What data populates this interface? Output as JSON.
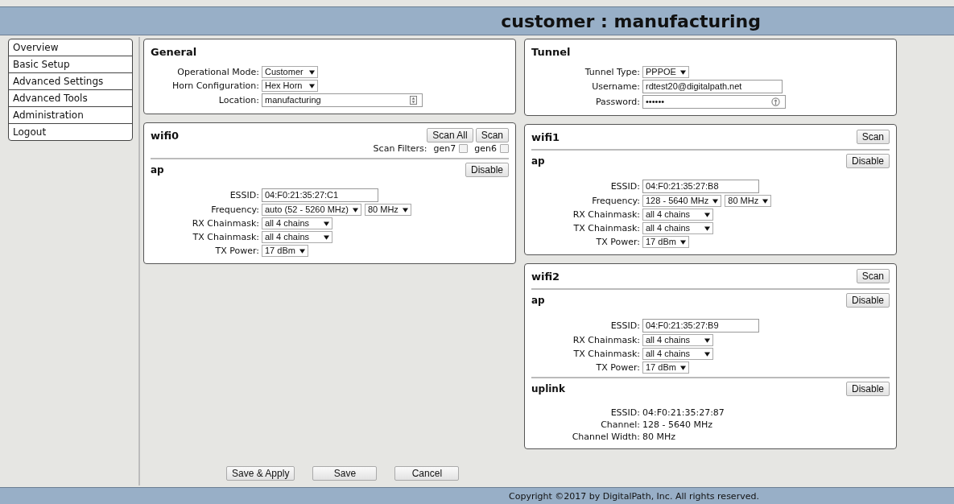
{
  "header": {
    "title": "customer : manufacturing"
  },
  "nav": [
    {
      "label": "Overview"
    },
    {
      "label": "Basic Setup"
    },
    {
      "label": "Advanced Settings"
    },
    {
      "label": "Advanced Tools"
    },
    {
      "label": "Administration"
    },
    {
      "label": "Logout"
    }
  ],
  "columns": [
    [
      {
        "title": "General",
        "fields": [
          {
            "label": "Operational Mode:",
            "controls": [
              {
                "kind": "select",
                "value": "Customer"
              }
            ]
          },
          {
            "label": "Horn Configuration:",
            "controls": [
              {
                "kind": "select",
                "value": "Hex Horn"
              }
            ]
          },
          {
            "label": "Location:",
            "controls": [
              {
                "kind": "autofill_input",
                "value": "manufacturing"
              }
            ]
          }
        ]
      },
      {
        "title": "wifi0",
        "buttons": [
          "Scan All",
          "Scan"
        ],
        "filters_label": "Scan Filters:",
        "filters": [
          {
            "label": "gen7",
            "checked": false
          },
          {
            "label": "gen6",
            "checked": false
          }
        ],
        "sections": [
          {
            "title": "ap",
            "button": "Disable",
            "fields": [
              {
                "label": "ESSID:",
                "controls": [
                  {
                    "kind": "input",
                    "value": "04:F0:21:35:27:C1"
                  }
                ]
              },
              {
                "label": "Frequency:",
                "controls": [
                  {
                    "kind": "select",
                    "value": "auto (52 - 5260 MHz)"
                  },
                  {
                    "kind": "select",
                    "value": "80 MHz"
                  }
                ]
              },
              {
                "label": "RX Chainmask:",
                "controls": [
                  {
                    "kind": "select",
                    "value": "all 4 chains"
                  }
                ]
              },
              {
                "label": "TX Chainmask:",
                "controls": [
                  {
                    "kind": "select",
                    "value": "all 4 chains"
                  }
                ]
              },
              {
                "label": "TX Power:",
                "controls": [
                  {
                    "kind": "select",
                    "value": "17 dBm"
                  }
                ]
              }
            ]
          }
        ]
      }
    ],
    [
      {
        "title": "Tunnel",
        "fields": [
          {
            "label": "Tunnel Type:",
            "controls": [
              {
                "kind": "select",
                "value": "PPPOE"
              }
            ]
          },
          {
            "label": "Username:",
            "controls": [
              {
                "kind": "input",
                "value": "rdtest20@digitalpath.net"
              }
            ]
          },
          {
            "label": "Password:",
            "controls": [
              {
                "kind": "password",
                "value": "••••••"
              }
            ]
          }
        ]
      },
      {
        "title": "wifi1",
        "buttons": [
          "Scan"
        ],
        "sections": [
          {
            "title": "ap",
            "button": "Disable",
            "fields": [
              {
                "label": "ESSID:",
                "controls": [
                  {
                    "kind": "input",
                    "value": "04:F0:21:35:27:B8"
                  }
                ]
              },
              {
                "label": "Frequency:",
                "controls": [
                  {
                    "kind": "select",
                    "value": "128 - 5640 MHz"
                  },
                  {
                    "kind": "select",
                    "value": "80 MHz"
                  }
                ]
              },
              {
                "label": "RX Chainmask:",
                "controls": [
                  {
                    "kind": "select",
                    "value": "all 4 chains"
                  }
                ]
              },
              {
                "label": "TX Chainmask:",
                "controls": [
                  {
                    "kind": "select",
                    "value": "all 4 chains"
                  }
                ]
              },
              {
                "label": "TX Power:",
                "controls": [
                  {
                    "kind": "select",
                    "value": "17 dBm"
                  }
                ]
              }
            ]
          }
        ]
      },
      {
        "title": "wifi2",
        "buttons": [
          "Scan"
        ],
        "sections": [
          {
            "title": "ap",
            "button": "Disable",
            "fields": [
              {
                "label": "ESSID:",
                "controls": [
                  {
                    "kind": "input",
                    "value": "04:F0:21:35:27:B9"
                  }
                ]
              },
              {
                "label": "RX Chainmask:",
                "controls": [
                  {
                    "kind": "select",
                    "value": "all 4 chains"
                  }
                ]
              },
              {
                "label": "TX Chainmask:",
                "controls": [
                  {
                    "kind": "select",
                    "value": "all 4 chains"
                  }
                ]
              },
              {
                "label": "TX Power:",
                "controls": [
                  {
                    "kind": "select",
                    "value": "17 dBm"
                  }
                ]
              }
            ]
          },
          {
            "title": "uplink",
            "button": "Disable",
            "fields": [
              {
                "label": "ESSID:",
                "controls": [
                  {
                    "kind": "static",
                    "value": "04:F0:21:35:27:87"
                  }
                ]
              },
              {
                "label": "Channel:",
                "controls": [
                  {
                    "kind": "static",
                    "value": "128 - 5640 MHz"
                  }
                ]
              },
              {
                "label": "Channel Width:",
                "controls": [
                  {
                    "kind": "static",
                    "value": "80 MHz"
                  }
                ]
              }
            ]
          }
        ]
      }
    ]
  ],
  "actions": [
    "Save & Apply",
    "Save",
    "Cancel"
  ],
  "footer": "Copyright ©2017 by DigitalPath, Inc. All rights reserved."
}
